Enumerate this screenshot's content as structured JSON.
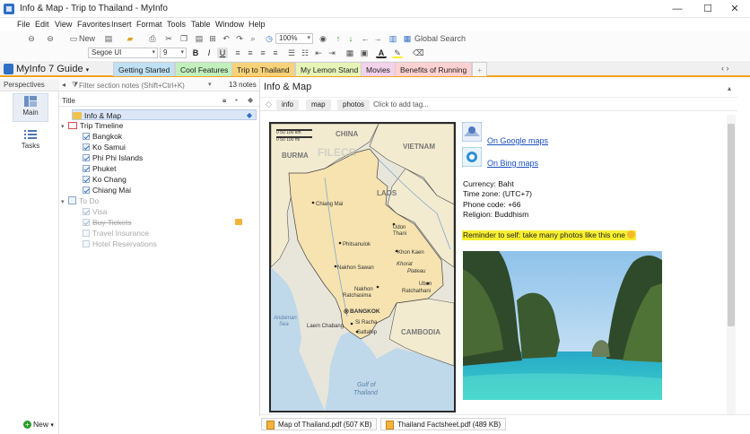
{
  "window": {
    "title": "Info & Map - Trip to Thailand - MyInfo",
    "controls": [
      "—",
      "☐",
      "✕"
    ]
  },
  "menu": [
    "File",
    "Edit",
    "View",
    "Favorites",
    "Insert",
    "Format",
    "Tools",
    "Table",
    "Window",
    "Help"
  ],
  "toolbar": {
    "new_label": "New",
    "zoom": "100%",
    "global_search": "Global Search",
    "font": "Segoe UI",
    "font_size": "9",
    "bold": "B",
    "italic": "I",
    "underline": "U",
    "strike": "A"
  },
  "doc": {
    "title": "MyInfo 7 Guide",
    "tabs": [
      {
        "label": "Getting Started",
        "color": "#bfe1f5"
      },
      {
        "label": "Cool Features",
        "color": "#c2f0bc"
      },
      {
        "label": "Trip to Thailand",
        "color": "#f8d278"
      },
      {
        "label": "My Lemon Stand",
        "color": "#e6f5b6"
      },
      {
        "label": "Movies",
        "color": "#f3d2ec"
      },
      {
        "label": "Benefits of Running",
        "color": "#ffd1d1"
      }
    ],
    "add_tab": "+",
    "scroll_arrows": "‹ ›"
  },
  "perspectives": {
    "header": "Perspectives",
    "main": "Main",
    "tasks": "Tasks",
    "new": "New"
  },
  "tree": {
    "filter_placeholder": "Filter section notes (Shift+Ctrl+K)",
    "count": "13 notes",
    "column_title": "Title",
    "items": [
      {
        "label": "Info & Map",
        "selected": true
      },
      {
        "label": "Trip Timeline"
      },
      {
        "label": "Bangkok"
      },
      {
        "label": "Ko Samui"
      },
      {
        "label": "Phi Phi Islands"
      },
      {
        "label": "Phuket"
      },
      {
        "label": "Ko Chang"
      },
      {
        "label": "Chiang Mai"
      },
      {
        "label": "To Do"
      },
      {
        "label": "Visa"
      },
      {
        "label": "Buy Tickets"
      },
      {
        "label": "Travel Insurance"
      },
      {
        "label": "Hotel Reservations"
      }
    ]
  },
  "note": {
    "title": "Info & Map",
    "tags": [
      "info",
      "map",
      "photos"
    ],
    "add_tag": "Click to add tag...",
    "links": [
      "On Google maps",
      "On Bing maps"
    ],
    "facts": [
      "Currency: Baht",
      "Time zone: (UTC+7)",
      "Phone code: +66",
      "Religion: Buddhism"
    ],
    "reminder": "Reminder to self: take many photos like this one",
    "map": {
      "scale_km": "0   50  100 km",
      "scale_mi": "0   50   100 mi",
      "watermark": "FILECR",
      "labels": {
        "china": "CHINA",
        "burma": "BURMA",
        "vietnam": "VIETNAM",
        "laos": "LAOS",
        "cambodia": "CAMBODIA",
        "chiang_mai": "Chiang Mai",
        "udon_thani": "Udon\nThani",
        "phitsanulok": "Phitsanulok",
        "khon_kaen": "Khon Kaen",
        "khorat_plateau": "Khorat\nPlateau",
        "nakhon_sawan": "Nakhon Sawan",
        "nakhon_ratchasima": "Nakhon\nRatchasima",
        "ubon_ratchathani": "Ubon\nRatchathani",
        "bangkok": "BANGKOK",
        "laem_chabang": "Laem Chabang",
        "si_racha": "Si Racha",
        "sattahip": "Sattahip",
        "andaman_sea": "Andaman\nSea",
        "gulf_of_thailand": "Gulf of\nThailand"
      }
    }
  },
  "attachments": [
    {
      "label": "Map of Thailand.pdf (507 KB)"
    },
    {
      "label": "Thailand Factsheet.pdf (489 KB)"
    }
  ]
}
